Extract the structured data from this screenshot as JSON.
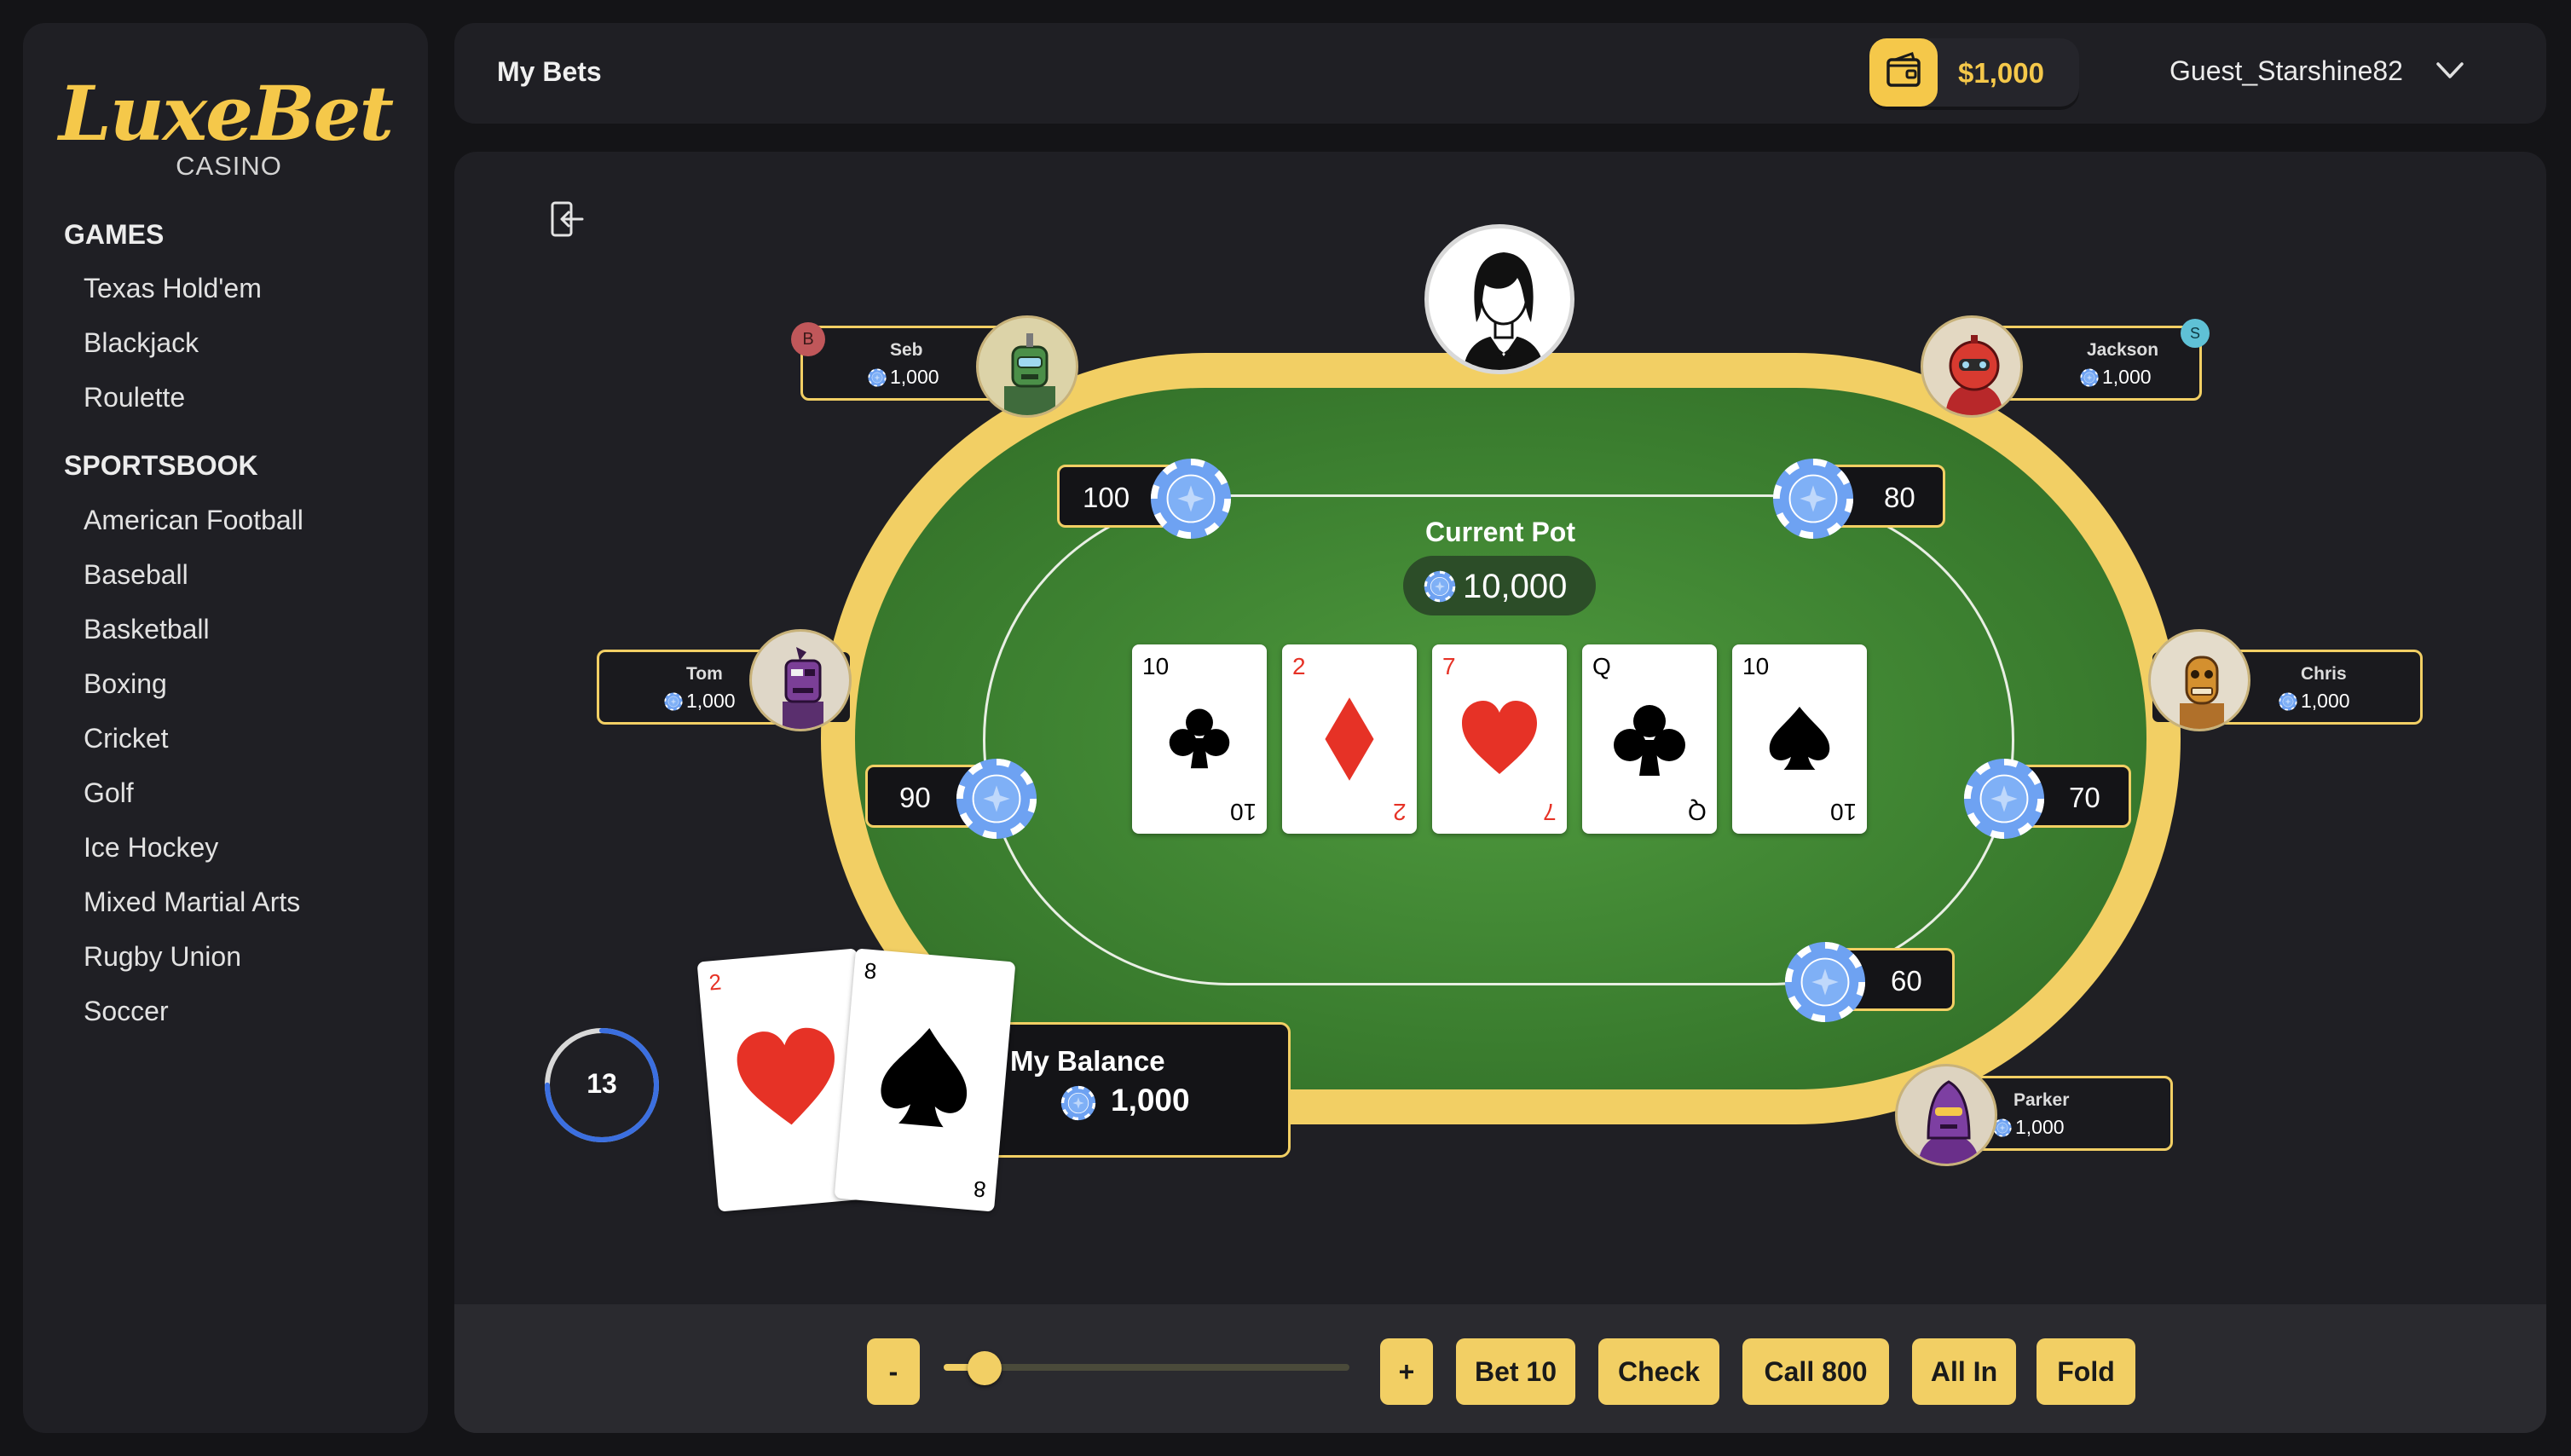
{
  "brand": {
    "name": "LuxeBet",
    "sub": "CASINO",
    "accent": "#f5c84a"
  },
  "sidebar": {
    "games_title": "GAMES",
    "games": [
      "Texas Hold'em",
      "Blackjack",
      "Roulette"
    ],
    "sports_title": "SPORTSBOOK",
    "sports": [
      "American Football",
      "Baseball",
      "Basketball",
      "Boxing",
      "Cricket",
      "Golf",
      "Ice Hockey",
      "Mixed Martial Arts",
      "Rugby Union",
      "Soccer"
    ]
  },
  "header": {
    "title": "My Bets",
    "wallet_amount": "$1,000",
    "username": "Guest_Starshine82"
  },
  "table": {
    "pot_label": "Current Pot",
    "pot_amount": "10,000",
    "community": [
      {
        "rank": "10",
        "suit": "clubs",
        "color": "black"
      },
      {
        "rank": "2",
        "suit": "diamonds",
        "color": "red"
      },
      {
        "rank": "7",
        "suit": "hearts",
        "color": "red"
      },
      {
        "rank": "Q",
        "suit": "clubs",
        "color": "black"
      },
      {
        "rank": "10",
        "suit": "spades",
        "color": "black"
      }
    ],
    "bets": {
      "seb": "100",
      "jackson": "80",
      "tom": "90",
      "chris": "70",
      "parker": "60"
    }
  },
  "players": {
    "seb": {
      "name": "Seb",
      "balance": "1,000",
      "tag": "B"
    },
    "jackson": {
      "name": "Jackson",
      "balance": "1,000",
      "tag": "S"
    },
    "tom": {
      "name": "Tom",
      "balance": "1,000"
    },
    "chris": {
      "name": "Chris",
      "balance": "1,000"
    },
    "parker": {
      "name": "Parker",
      "balance": "1,000"
    }
  },
  "me": {
    "timer": "13",
    "timer_progress": 0.75,
    "balance_label": "My Balance",
    "balance": "1,000",
    "hand": [
      {
        "rank": "2",
        "suit": "hearts",
        "color": "red"
      },
      {
        "rank": "8",
        "suit": "spades",
        "color": "black"
      }
    ]
  },
  "actions": {
    "minus": "-",
    "plus": "+",
    "bet": "Bet 10",
    "check": "Check",
    "call": "Call 800",
    "allin": "All In",
    "fold": "Fold",
    "slider_value": 0.1
  }
}
